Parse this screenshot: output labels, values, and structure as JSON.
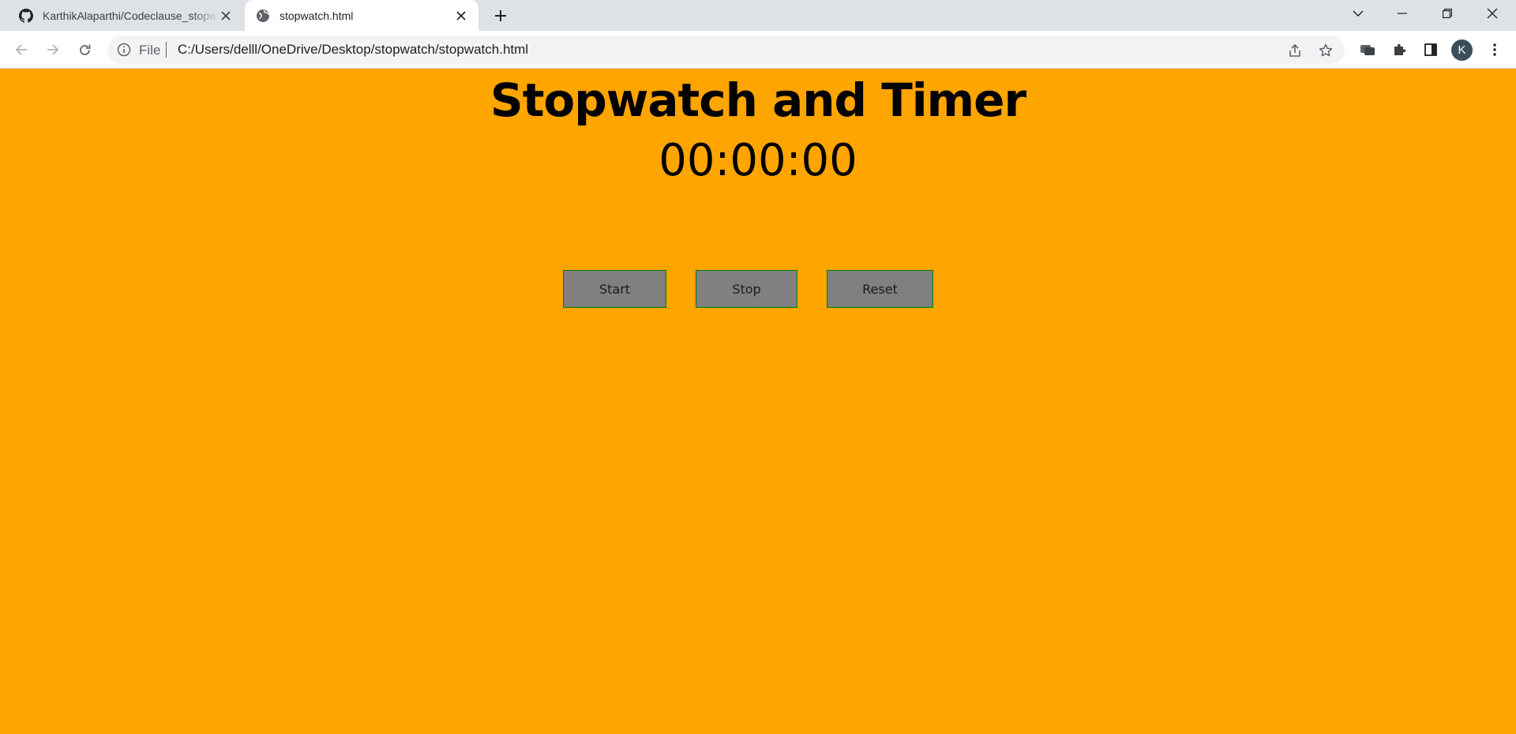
{
  "browser": {
    "tabs": [
      {
        "title": "KarthikAlaparthi/Codeclause_stopwatch",
        "active": false,
        "icon": "github-icon"
      },
      {
        "title": "stopwatch.html",
        "active": true,
        "icon": "globe-icon"
      }
    ],
    "address": {
      "scheme_label": "File",
      "url": "C:/Users/delll/OneDrive/Desktop/stopwatch/stopwatch.html"
    },
    "profile_initial": "K"
  },
  "page": {
    "heading": "Stopwatch and Timer",
    "time_display": "00:00:00",
    "buttons": {
      "start": "Start",
      "stop": "Stop",
      "reset": "Reset"
    },
    "background_color": "#ffa500",
    "button_color": "#808080",
    "button_border_color": "#008000"
  }
}
